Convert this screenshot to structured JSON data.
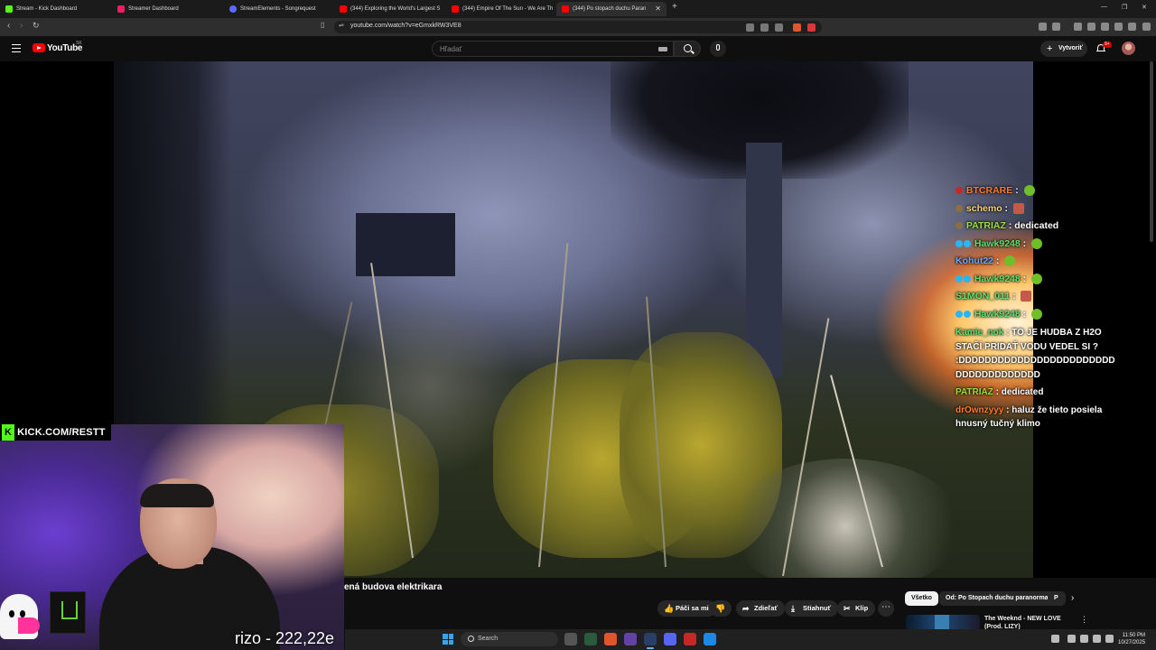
{
  "browser": {
    "tabs": [
      {
        "label": "Stream - Kick Dashboard",
        "color": "#53fc18"
      },
      {
        "label": "Streamer Dashboard",
        "color": "#e91e63"
      },
      {
        "label": "StreamElements - Songrequest",
        "color": "#5a6bff"
      },
      {
        "label": "(344) Exploring the World's Largest S",
        "color": "#ff0000"
      },
      {
        "label": "(344) Empire Of The Sun - We Are Th",
        "color": "#ff0000"
      },
      {
        "label": "(344) Po stopach duchu Paran",
        "color": "#ff0000",
        "active": true
      }
    ],
    "url": "youtube.com/watch?v=eGmxkRW3VE8"
  },
  "youtube": {
    "logo_text": "YouTube",
    "country_code": "SK",
    "search_placeholder": "Hľadať",
    "create_label": "Vytvoriť",
    "notif_count": "9+"
  },
  "chat": [
    {
      "user": "BTCRARE",
      "color": "#ff7b2e",
      "text": ":",
      "emote": "green"
    },
    {
      "user": "schemo",
      "color": "#ffd27a",
      "text": ":",
      "emote": "box"
    },
    {
      "user": "PATRIAZ",
      "color": "#9be23b",
      "text": ": dedicated"
    },
    {
      "user": "Hawk9248",
      "color": "#5ee36a",
      "text": ":",
      "emote": "green"
    },
    {
      "user": "Kohut22",
      "color": "#6aa8ff",
      "text": ":",
      "emote": "green"
    },
    {
      "user": "Hawk9248",
      "color": "#5ee36a",
      "text": ":",
      "emote": "green"
    },
    {
      "user": "S1MON_011",
      "color": "#5ee36a",
      "text": ":",
      "emote": "box"
    },
    {
      "user": "Hawk9248",
      "color": "#5ee36a",
      "text": ":",
      "emote": "green"
    }
  ],
  "chat_long": [
    {
      "user": "Kamie_nok",
      "color": "#5ee36a",
      "text": ": TO JE HUDBA Z H2O STAČÍ PRIDAŤ VODU VEDEL SI ?"
    },
    {
      "user": "",
      "color": "#ffffff",
      "text": ":DDDDDDDDDDDDDDDDDDDDDDDDDDDDDDDDDDDDD"
    },
    {
      "user": "PATRIAZ",
      "color": "#9be23b",
      "text": ": dedicated"
    },
    {
      "user": "drOwnzyyy",
      "color": "#ff7b2e",
      "text": ": haluz že tieto posiela hnusný tučný klimo"
    }
  ],
  "overlay": {
    "kick_logo": "K",
    "kick_url": "KICK.COM/RESTT",
    "caption": "rizo - 222,22e"
  },
  "video": {
    "title": "ená budova elektrikara"
  },
  "actions": [
    {
      "label": "Páči sa mi",
      "icon": "👍"
    },
    {
      "label": "",
      "icon": "👎"
    },
    {
      "label": "Zdieľať",
      "icon": "➦"
    },
    {
      "label": "Stiahnuť",
      "icon": "⤓"
    },
    {
      "label": "Klip",
      "icon": "✂"
    }
  ],
  "chips": [
    "Všetko",
    "Od: Po Stopach duchu paranormal",
    "P"
  ],
  "suggestion": {
    "title": "The Weeknd - NEW LOVE (Prod. LIZY)"
  },
  "taskbar": {
    "search_label": "Search",
    "time": "11:50 PM",
    "date": "10/27/2025"
  }
}
